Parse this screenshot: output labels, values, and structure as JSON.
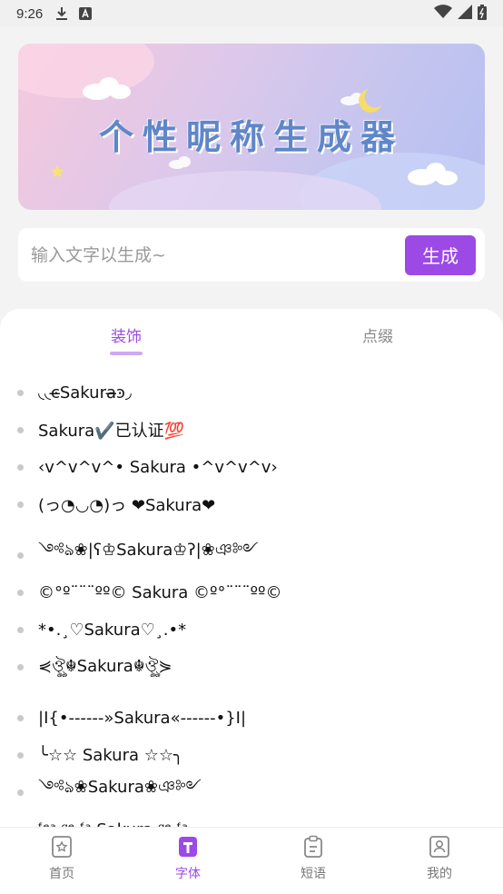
{
  "status_bar": {
    "time": "9:26",
    "icons": [
      "download-icon",
      "a-box-icon",
      "wifi-icon",
      "signal-icon",
      "battery-icon"
    ]
  },
  "banner": {
    "title": "个性昵称生成器",
    "colors": {
      "title": "#5f86c8",
      "gradient_start": "#f6c9dc",
      "gradient_end": "#b5bff0"
    }
  },
  "search": {
    "placeholder": "输入文字以生成~",
    "button_label": "生成"
  },
  "tabs": [
    {
      "label": "装饰",
      "active": true
    },
    {
      "label": "点缀",
      "active": false
    }
  ],
  "nicknames": [
    "◟◟ͼ̶Sakura̶ͽ◞",
    "Sakura✔️已认证💯",
    "‹v^v^v^• Sakura •^v^v^v›",
    "(っ◔◡◔)っ ❤Sakura❤",
    "༺ঌ❀|ʕ♔Sakura♔ʔ|❀ঞ༻",
    "©°º¨¨¨ºº© Sakura ©º°¨¨¨ºº©",
    "*•.¸♡Sakura♡¸.•*",
    "⋞ঔৣ☬Sakura☬ঔৣ⋟",
    "|I{•------»Sakura«------•}I|",
    "╰☆☆ Sakura ☆☆╮",
    "༺ঌ❀Sakura❀ঞ༻",
    "ᶠᵉᵃ ᵍᵉ ᶠᵃ Sakura ᵍᵉ ᶠᵃ"
  ],
  "bottom_nav": [
    {
      "label": "首页",
      "icon": "star-page-icon",
      "active": false
    },
    {
      "label": "字体",
      "icon": "font-t-icon",
      "active": true
    },
    {
      "label": "短语",
      "icon": "clipboard-icon",
      "active": false
    },
    {
      "label": "我的",
      "icon": "profile-icon",
      "active": false
    }
  ],
  "colors": {
    "accent": "#9b4ae6",
    "tab_underline": "#cfa9f5"
  }
}
